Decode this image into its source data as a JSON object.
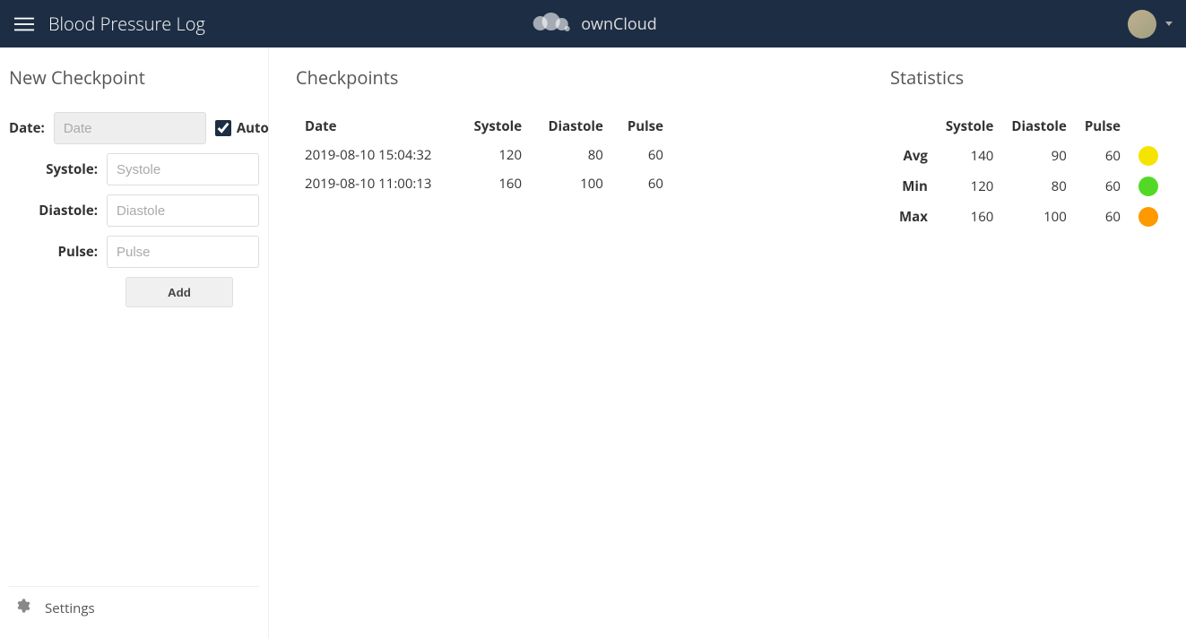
{
  "header": {
    "app_title": "Blood Pressure Log",
    "brand": "ownCloud"
  },
  "form": {
    "section_title": "New Checkpoint",
    "date_label": "Date:",
    "date_placeholder": "Date",
    "systole_label": "Systole:",
    "systole_placeholder": "Systole",
    "diastole_label": "Diastole:",
    "diastole_placeholder": "Diastole",
    "pulse_label": "Pulse:",
    "pulse_placeholder": "Pulse",
    "auto_label": "Auto",
    "add_button": "Add"
  },
  "checkpoints": {
    "section_title": "Checkpoints",
    "headers": {
      "date": "Date",
      "systole": "Systole",
      "diastole": "Diastole",
      "pulse": "Pulse"
    },
    "rows": [
      {
        "date": "2019-08-10 15:04:32",
        "systole": "120",
        "diastole": "80",
        "pulse": "60"
      },
      {
        "date": "2019-08-10 11:00:13",
        "systole": "160",
        "diastole": "100",
        "pulse": "60"
      }
    ]
  },
  "stats": {
    "section_title": "Statistics",
    "headers": {
      "systole": "Systole",
      "diastole": "Diastole",
      "pulse": "Pulse"
    },
    "rows": {
      "avg": {
        "label": "Avg",
        "systole": "140",
        "diastole": "90",
        "pulse": "60",
        "color": "#f5e400"
      },
      "min": {
        "label": "Min",
        "systole": "120",
        "diastole": "80",
        "pulse": "60",
        "color": "#53d925"
      },
      "max": {
        "label": "Max",
        "systole": "160",
        "diastole": "100",
        "pulse": "60",
        "color": "#ff9900"
      }
    }
  },
  "footer": {
    "settings": "Settings"
  }
}
